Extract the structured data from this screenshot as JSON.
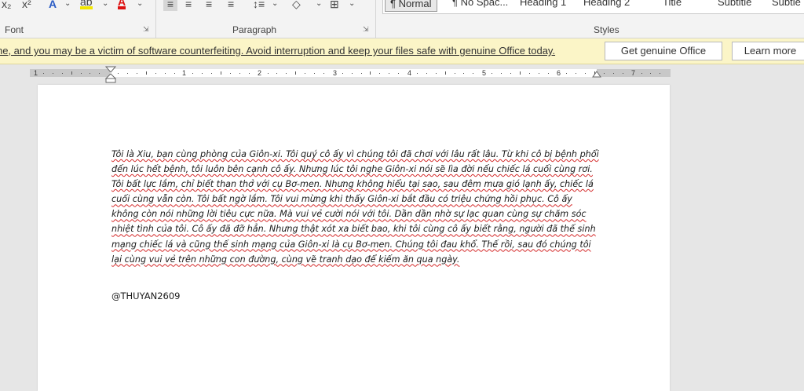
{
  "ribbon": {
    "groups": {
      "font": "Font",
      "paragraph": "Paragraph",
      "styles": "Styles"
    },
    "font_tools": {
      "subscript": "x₂",
      "superscript": "x²",
      "text_effects": "A",
      "highlight": "ab",
      "font_color": "A"
    },
    "styles_gallery": [
      "¶ Normal",
      "¶ No Spac...",
      "Heading 1",
      "Heading 2",
      "Title",
      "Subtitle",
      "Subtle"
    ]
  },
  "message_bar": {
    "text": "ne, and you may be a victim of software counterfeiting. Avoid interruption and keep your files safe with genuine Office today.",
    "get_genuine_label": "Get genuine Office",
    "learn_more_label": "Learn more"
  },
  "ruler": {
    "numbers": [
      "1",
      "1",
      "2",
      "3",
      "4",
      "5",
      "6",
      "7"
    ]
  },
  "document": {
    "paragraph": "Tôi là Xiu, bạn cùng phòng của Giôn-xi. Tôi quý cô ấy vì chúng tôi đã chơi với lâu rất lâu. Từ khi cô bị bệnh phổi đến lúc hết bệnh, tôi luôn bên cạnh cô ấy. Nhưng lúc tôi nghe Giôn-xi nói sẽ lìa đời nếu chiếc lá cuối cùng rơi. Tôi bất lực lắm, chỉ biết than thở với cụ Bơ-men. Nhưng không hiểu tại sao, sau đêm mưa gió lạnh ấy, chiếc lá cuối cùng vẫn còn. Tôi bất ngờ lắm. Tôi vui mừng khi thấy Giôn-xi bắt đầu có triệu chứng hồi phục. Cô ấy không còn nói những lời tiêu cực nữa. Mà vui vẻ cười nói với tôi. Dần dần nhờ sự lạc quan cùng sự chăm sóc nhiệt tình của tôi. Cô ấy đã đỡ hẳn. Nhưng thật xót xa biết bao, khi tôi cùng cô ấy biết rằng, người đã thế sinh mạng chiếc lá và cũng thế sinh mạng của Giôn-xi là cụ Bơ-men. Chúng tôi đau khổ. Thế rồi, sau đó chúng tôi lại cùng vui vẻ trên những con đường, cùng vẽ tranh dạo để kiếm ăn qua ngày.",
    "author": "@THUYAN2609"
  }
}
